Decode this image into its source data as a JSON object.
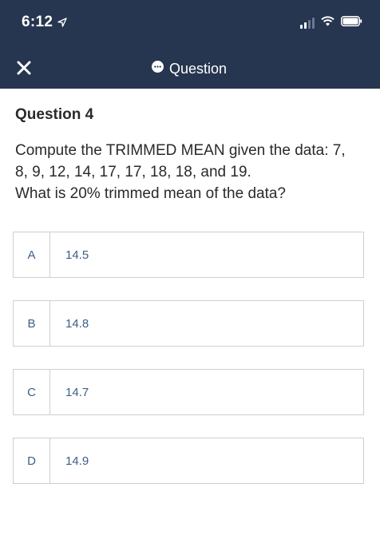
{
  "status_bar": {
    "time": "6:12"
  },
  "nav": {
    "title": "Question"
  },
  "question": {
    "heading": "Question 4",
    "lines": [
      "Compute the TRIMMED MEAN given the data: 7,",
      "8, 9, 12, 14, 17, 17, 18, 18, and 19.",
      "What is 20% trimmed mean of the data?"
    ]
  },
  "options": [
    {
      "letter": "A",
      "value": "14.5"
    },
    {
      "letter": "B",
      "value": "14.8"
    },
    {
      "letter": "C",
      "value": "14.7"
    },
    {
      "letter": "D",
      "value": "14.9"
    }
  ],
  "colors": {
    "header_bg": "#263650",
    "option_text": "#3e5f86",
    "border": "#cfcfcf"
  }
}
